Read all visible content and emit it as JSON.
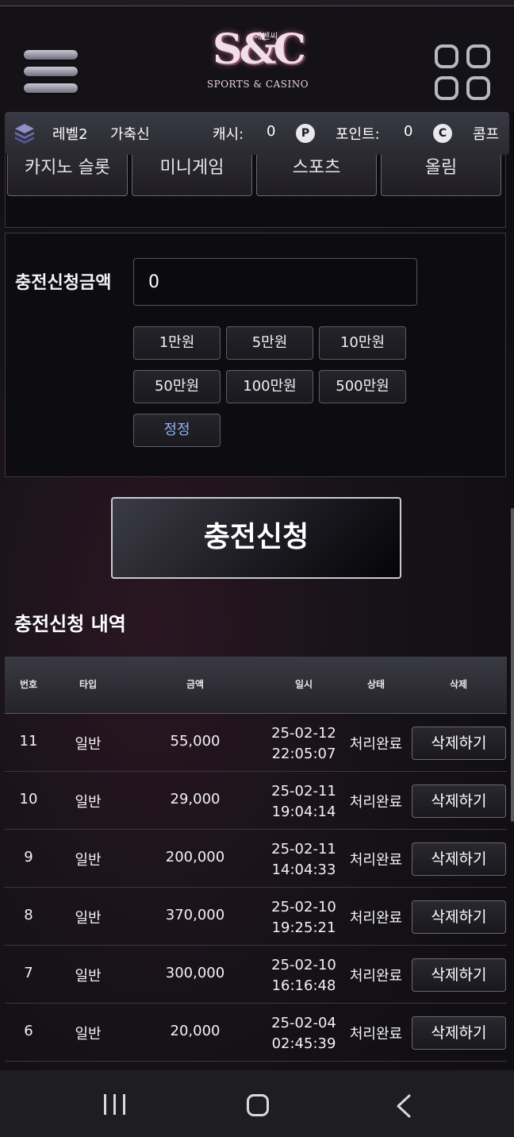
{
  "header": {
    "logo_mark": "S&C",
    "logo_sub": "에쎈씨",
    "logo_text": "SPORTS & CASINO"
  },
  "userbar": {
    "level": "레벨2",
    "username": "가축신",
    "cash_label": "캐시:",
    "cash_value": "0",
    "point_label": "포인트:",
    "point_value": "0",
    "comp_label": "콤프",
    "point_icon": "P",
    "comp_icon": "C"
  },
  "tabs": [
    "카지노 슬롯",
    "미니게임",
    "스포츠",
    "올림"
  ],
  "charge": {
    "label": "충전신청금액",
    "amount_value": "0",
    "amount_buttons": [
      "1만원",
      "5만원",
      "10만원",
      "50만원",
      "100만원",
      "500만원"
    ],
    "reset_label": "정정",
    "submit_label": "충전신청"
  },
  "history": {
    "title": "충전신청 내역",
    "columns": [
      "번호",
      "타입",
      "금액",
      "일시",
      "상태",
      "삭제"
    ],
    "rows": [
      {
        "no": "11",
        "type": "일반",
        "amount": "55,000",
        "date": "25-02-12",
        "time": "22:05:07",
        "status": "처리완료",
        "action": "삭제하기"
      },
      {
        "no": "10",
        "type": "일반",
        "amount": "29,000",
        "date": "25-02-11",
        "time": "19:04:14",
        "status": "처리완료",
        "action": "삭제하기"
      },
      {
        "no": "9",
        "type": "일반",
        "amount": "200,000",
        "date": "25-02-11",
        "time": "14:04:33",
        "status": "처리완료",
        "action": "삭제하기"
      },
      {
        "no": "8",
        "type": "일반",
        "amount": "370,000",
        "date": "25-02-10",
        "time": "19:25:21",
        "status": "처리완료",
        "action": "삭제하기"
      },
      {
        "no": "7",
        "type": "일반",
        "amount": "300,000",
        "date": "25-02-10",
        "time": "16:16:48",
        "status": "처리완료",
        "action": "삭제하기"
      },
      {
        "no": "6",
        "type": "일반",
        "amount": "20,000",
        "date": "25-02-04",
        "time": "02:45:39",
        "status": "처리완료",
        "action": "삭제하기"
      }
    ]
  },
  "colors": {
    "accent_blue": "#8ab4f8",
    "background": "#14111a"
  }
}
